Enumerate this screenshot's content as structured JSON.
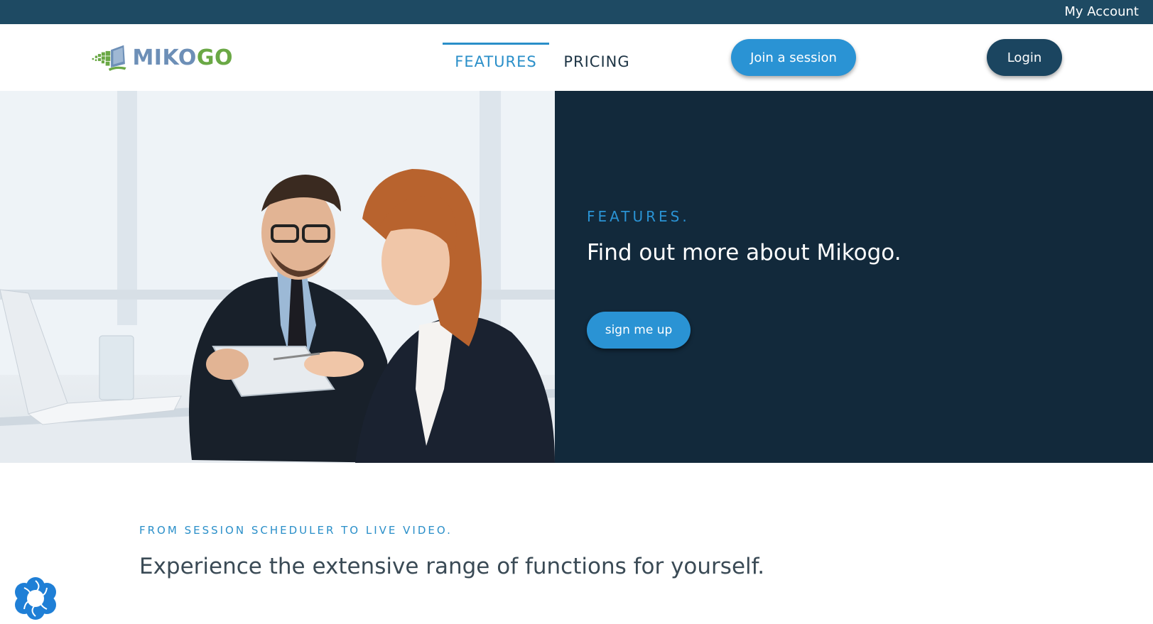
{
  "top_bar": {
    "account_label": "My Account"
  },
  "header": {
    "logo": {
      "text_main": "MIKO",
      "text_accent": "GO"
    },
    "nav": [
      {
        "label": "FEATURES",
        "active": true
      },
      {
        "label": "PRICING",
        "active": false
      }
    ],
    "join_button": "Join a session",
    "login_button": "Login"
  },
  "hero": {
    "kicker": "FEATURES.",
    "title": "Find out more about Mikogo.",
    "cta": "sign me up"
  },
  "features_intro": {
    "kicker": "FROM SESSION SCHEDULER TO LIVE VIDEO.",
    "title": "Experience the extensive range of functions for yourself."
  },
  "colors": {
    "top_bar": "#1e4a63",
    "accent": "#2a93d4",
    "dark_panel": "#12293b",
    "login_button": "#1b4560",
    "logo_green": "#6aa845",
    "logo_blue": "#6d8fb7"
  },
  "icons": {
    "floating_widget": "blue-flower-chat-icon"
  }
}
